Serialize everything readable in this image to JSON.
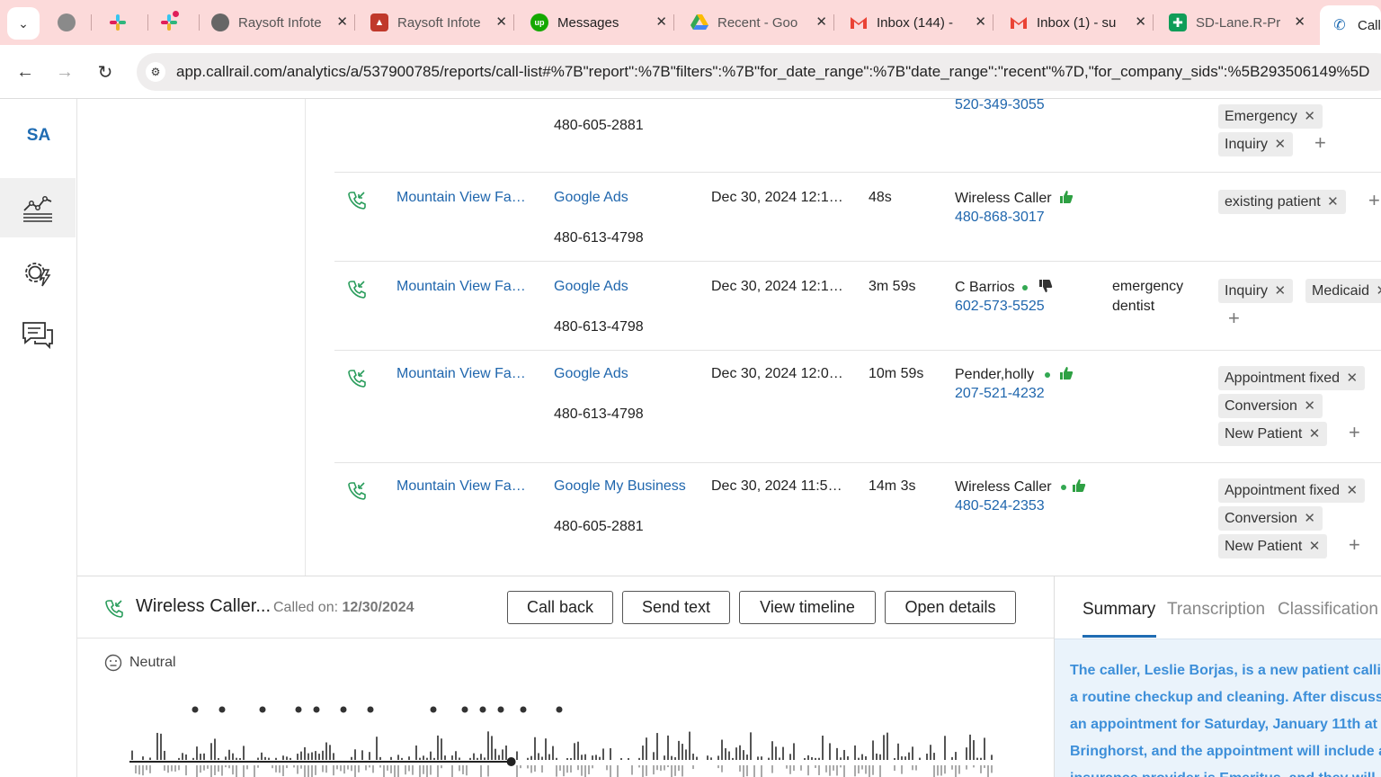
{
  "browser": {
    "tabs": [
      {
        "title": "",
        "icon": "globe-icon"
      },
      {
        "title": "",
        "icon": "slack-icon"
      },
      {
        "title": "",
        "icon": "slack-icon"
      },
      {
        "title": "Raysoft Infote",
        "icon": "globe-icon"
      },
      {
        "title": "Raysoft Infote",
        "icon": "graduation-cap-icon"
      },
      {
        "title": "Messages",
        "icon": "upwork-icon"
      },
      {
        "title": "Recent - Goo",
        "icon": "google-drive-icon"
      },
      {
        "title": "Inbox (144) -",
        "icon": "gmail-icon"
      },
      {
        "title": "Inbox (1) - su",
        "icon": "gmail-icon"
      },
      {
        "title": "SD-Lane.R-Pr",
        "icon": "google-sheets-icon"
      },
      {
        "title": "Call",
        "icon": "phone-icon"
      }
    ],
    "url": "app.callrail.com/analytics/a/537900785/reports/call-list#%7B\"report\":%7B\"filters\":%7B\"for_date_range\":%7B\"date_range\":\"recent\"%7D,\"for_company_sids\":%5B293506149%5D"
  },
  "sidebar": {
    "avatar": "SA",
    "items": [
      {
        "name": "analytics",
        "icon": "analytics-chart-icon",
        "active": true
      },
      {
        "name": "settings",
        "icon": "gear-bolt-icon",
        "active": false
      },
      {
        "name": "conversations",
        "icon": "chat-bubbles-icon",
        "active": false
      }
    ]
  },
  "calls": [
    {
      "company": "",
      "source": "",
      "tracking_number": "480-605-2881",
      "date": "",
      "duration": "",
      "caller": "",
      "caller_number": "520-349-3055",
      "keywords": "",
      "tags": [
        "Emergency",
        "Inquiry"
      ]
    },
    {
      "company": "Mountain View Fa…",
      "source": "Google Ads",
      "tracking_number": "480-613-4798",
      "date": "Dec 30, 2024 12:1…",
      "duration": "48s",
      "caller": "Wireless Caller",
      "caller_number": "480-868-3017",
      "keywords": "",
      "tags": [
        "existing patient"
      ]
    },
    {
      "company": "Mountain View Fa…",
      "source": "Google Ads",
      "tracking_number": "480-613-4798",
      "date": "Dec 30, 2024 12:1…",
      "duration": "3m 59s",
      "caller": "C Barrios",
      "caller_number": "602-573-5525",
      "keywords_line1": "emergency",
      "keywords_line2": "dentist",
      "tags": [
        "Inquiry",
        "Medicaid"
      ]
    },
    {
      "company": "Mountain View Fa…",
      "source": "Google Ads",
      "tracking_number": "480-613-4798",
      "date": "Dec 30, 2024 12:0…",
      "duration": "10m 59s",
      "caller": "Pender,holly",
      "caller_number": "207-521-4232",
      "keywords": "",
      "tags": [
        "Appointment fixed",
        "Conversion",
        "New Patient"
      ]
    },
    {
      "company": "Mountain View Fa…",
      "source": "Google My Business",
      "tracking_number": "480-605-2881",
      "date": "Dec 30, 2024 11:5…",
      "duration": "14m 3s",
      "caller": "Wireless Caller",
      "caller_number": "480-524-2353",
      "keywords": "",
      "tags": [
        "Appointment fixed",
        "Conversion",
        "New Patient"
      ]
    }
  ],
  "detail": {
    "title": "Wireless Caller...",
    "called_on_label": "Called on:",
    "called_on_date": "12/30/2024",
    "buttons": {
      "call_back": "Call back",
      "send_text": "Send text",
      "view_timeline": "View timeline",
      "open_details": "Open details"
    },
    "sentiment": "Neutral",
    "playback_position": 0.44,
    "tabs": [
      "Summary",
      "Transcription",
      "Classification"
    ],
    "summary_lines": [
      "The caller, Leslie Borjas, is a new patient calling",
      "a routine checkup and cleaning. After discussin",
      "an appointment for Saturday, January 11th at",
      "Bringhorst, and the appointment will include a",
      "insurance provider is Emeritus, and they will"
    ]
  }
}
